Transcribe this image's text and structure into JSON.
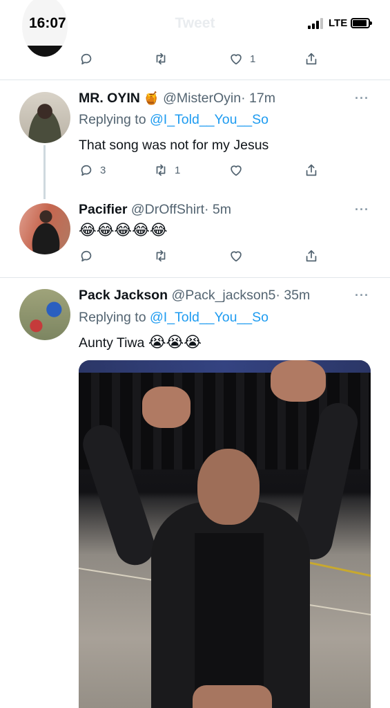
{
  "status_bar": {
    "time": "16:07",
    "title": "Tweet",
    "network": "LTE",
    "icons": [
      "signal-icon",
      "battery-icon"
    ]
  },
  "previous_tweet": {
    "actions": {
      "reply": "",
      "retweet": "",
      "like": "1",
      "share": ""
    }
  },
  "tweets": [
    {
      "name": "MR. OYIN",
      "badge_emoji": "🍯",
      "handle": "@MisterOyin",
      "time": "· 17m",
      "replying_prefix": "Replying to",
      "replying_to": "@I_Told__You__So",
      "text": "That song was not for my Jesus",
      "actions": {
        "reply": "3",
        "retweet": "1",
        "like": "",
        "share": ""
      }
    },
    {
      "name": "Pacifier",
      "handle": "@DrOffShirt",
      "time": "· 5m",
      "text": "😂😂😂😂😂",
      "actions": {
        "reply": "",
        "retweet": "",
        "like": "",
        "share": ""
      }
    },
    {
      "name": "Pack Jackson",
      "handle": "@Pack_jackson5",
      "time": "· 35m",
      "replying_prefix": "Replying to",
      "replying_to": "@I_Told__You__So",
      "text": "Aunty Tiwa",
      "text_emoji": "😭😭😭",
      "media": "video-thumbnail"
    }
  ],
  "more_label": "···",
  "colors": {
    "link": "#1d9bf0",
    "secondary_text": "#536471",
    "divider": "#e1e6ea"
  }
}
